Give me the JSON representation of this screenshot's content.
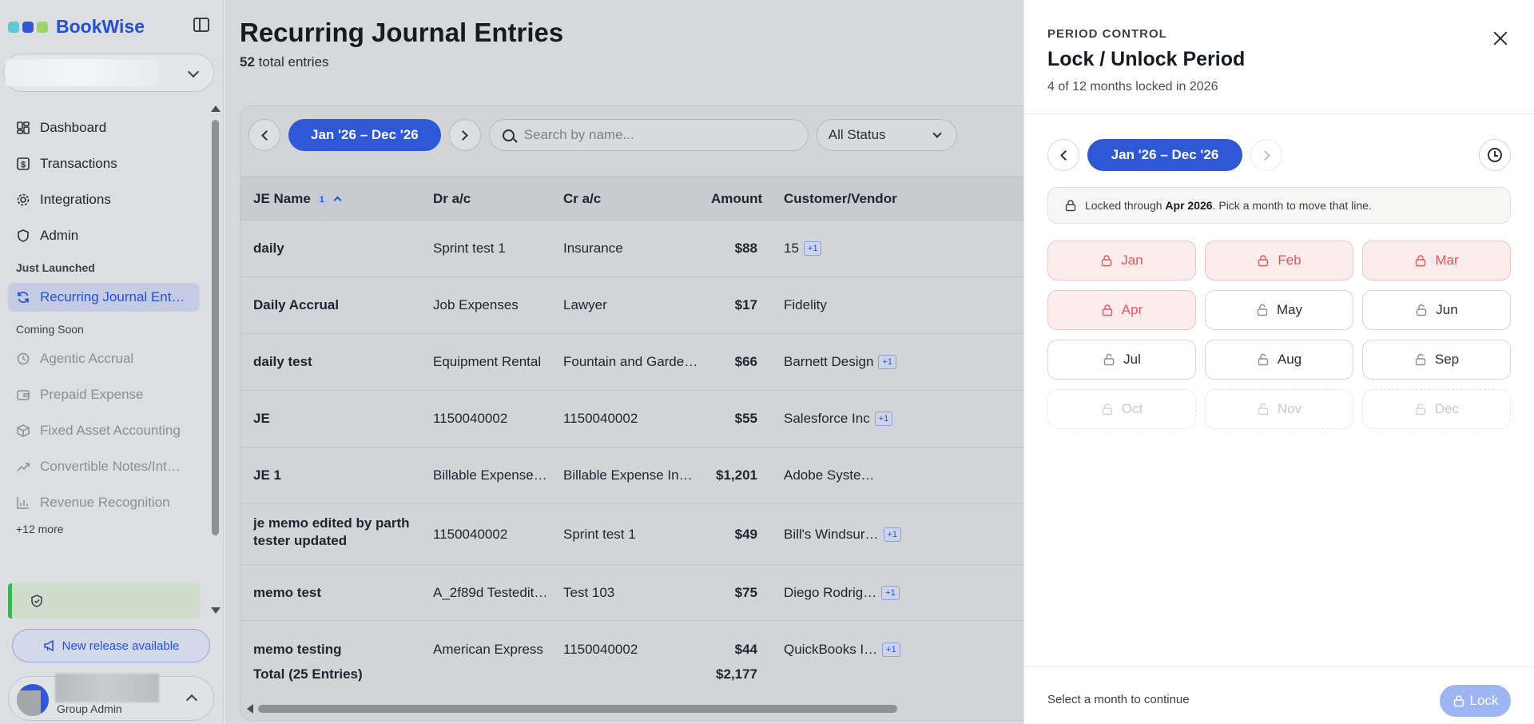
{
  "app": {
    "name": "BookWise",
    "brand_colors": [
      "#5ec8d9",
      "#2f58d7",
      "#9ad46a"
    ],
    "accent": "#2f58d7"
  },
  "sidebar": {
    "primary_items": [
      {
        "label": "Dashboard",
        "icon": "dashboard-icon"
      },
      {
        "label": "Transactions",
        "icon": "dollar-icon"
      },
      {
        "label": "Integrations",
        "icon": "gear-icon"
      },
      {
        "label": "Admin",
        "icon": "shield-icon"
      }
    ],
    "section_just_launched": "Just Launched",
    "just_launched_items": [
      {
        "label": "Recurring Journal Ent…",
        "icon": "refresh-icon",
        "active": true
      }
    ],
    "section_coming_soon": "Coming Soon",
    "coming_soon_items": [
      {
        "label": "Agentic Accrual",
        "icon": "sparkle-icon"
      },
      {
        "label": "Prepaid Expense",
        "icon": "wallet-icon"
      },
      {
        "label": "Fixed Asset Accounting",
        "icon": "box-icon"
      },
      {
        "label": "Convertible Notes/Int…",
        "icon": "trend-icon"
      },
      {
        "label": "Revenue Recognition",
        "icon": "bar-chart-icon"
      }
    ],
    "more_label": "+12 more",
    "release_label": "New release available",
    "user_role": "Group Admin"
  },
  "main": {
    "title": "Recurring Journal Entries",
    "total_count": "52",
    "total_suffix": "total entries",
    "toolbar": {
      "range_label": "Jan '26 – Dec '26",
      "search_placeholder": "Search by name...",
      "status_label": "All Status"
    },
    "columns": {
      "name": "JE Name",
      "sort_badge": "1",
      "dr": "Dr a/c",
      "cr": "Cr a/c",
      "amount": "Amount",
      "customer": "Customer/Vendor"
    },
    "rows": [
      {
        "name": "daily",
        "dr": "Sprint test 1",
        "cr": "Insurance",
        "amount": "$88",
        "customer": "15",
        "badge": "+1"
      },
      {
        "name": "Daily Accrual",
        "dr": "Job Expenses",
        "cr": "Lawyer",
        "amount": "$17",
        "customer": "Fidelity",
        "badge": ""
      },
      {
        "name": "daily test",
        "dr": "Equipment Rental",
        "cr": "Fountain and Garde…",
        "amount": "$66",
        "customer": "Barnett Design",
        "badge": "+1"
      },
      {
        "name": "JE",
        "dr": "1150040002",
        "cr": "1150040002",
        "amount": "$55",
        "customer": "Salesforce Inc",
        "badge": "+1"
      },
      {
        "name": "JE 1",
        "dr": "Billable Expense In…",
        "cr": "Billable Expense In…",
        "amount": "$1,201",
        "customer": "Adobe Syste…",
        "badge": ""
      },
      {
        "name": "je memo edited by parth tester updated",
        "dr": "1150040002",
        "cr": "Sprint test 1",
        "amount": "$49",
        "customer": "Bill's Windsur…",
        "badge": "+1"
      },
      {
        "name": "memo test",
        "dr": "A_2f89d Testedited…",
        "cr": "Test 103",
        "amount": "$75",
        "customer": "Diego Rodrig…",
        "badge": "+1"
      },
      {
        "name": "memo testing",
        "dr": "American Express",
        "cr": "1150040002",
        "amount": "$44",
        "customer": "QuickBooks I…",
        "badge": "+1"
      }
    ],
    "footer": {
      "label": "Total (25 Entries)",
      "amount": "$2,177"
    }
  },
  "drawer": {
    "eyebrow": "PERIOD CONTROL",
    "title": "Lock / Unlock Period",
    "subtitle": "4 of 12 months locked in 2026",
    "range_label": "Jan '26 – Dec '26",
    "notice_prefix": "Locked through",
    "notice_bold": "Apr 2026",
    "notice_suffix": ". Pick a month to move that line.",
    "months": [
      {
        "label": "Jan",
        "state": "locked"
      },
      {
        "label": "Feb",
        "state": "locked"
      },
      {
        "label": "Mar",
        "state": "locked"
      },
      {
        "label": "Apr",
        "state": "locked"
      },
      {
        "label": "May",
        "state": "open"
      },
      {
        "label": "Jun",
        "state": "open"
      },
      {
        "label": "Jul",
        "state": "open"
      },
      {
        "label": "Aug",
        "state": "open"
      },
      {
        "label": "Sep",
        "state": "open"
      },
      {
        "label": "Oct",
        "state": "future"
      },
      {
        "label": "Nov",
        "state": "future"
      },
      {
        "label": "Dec",
        "state": "future"
      }
    ],
    "footer_hint": "Select a month to continue",
    "lock_label": "Lock",
    "colors": {
      "locked_text": "#e0575b",
      "locked_bg": "#fcecec"
    }
  }
}
